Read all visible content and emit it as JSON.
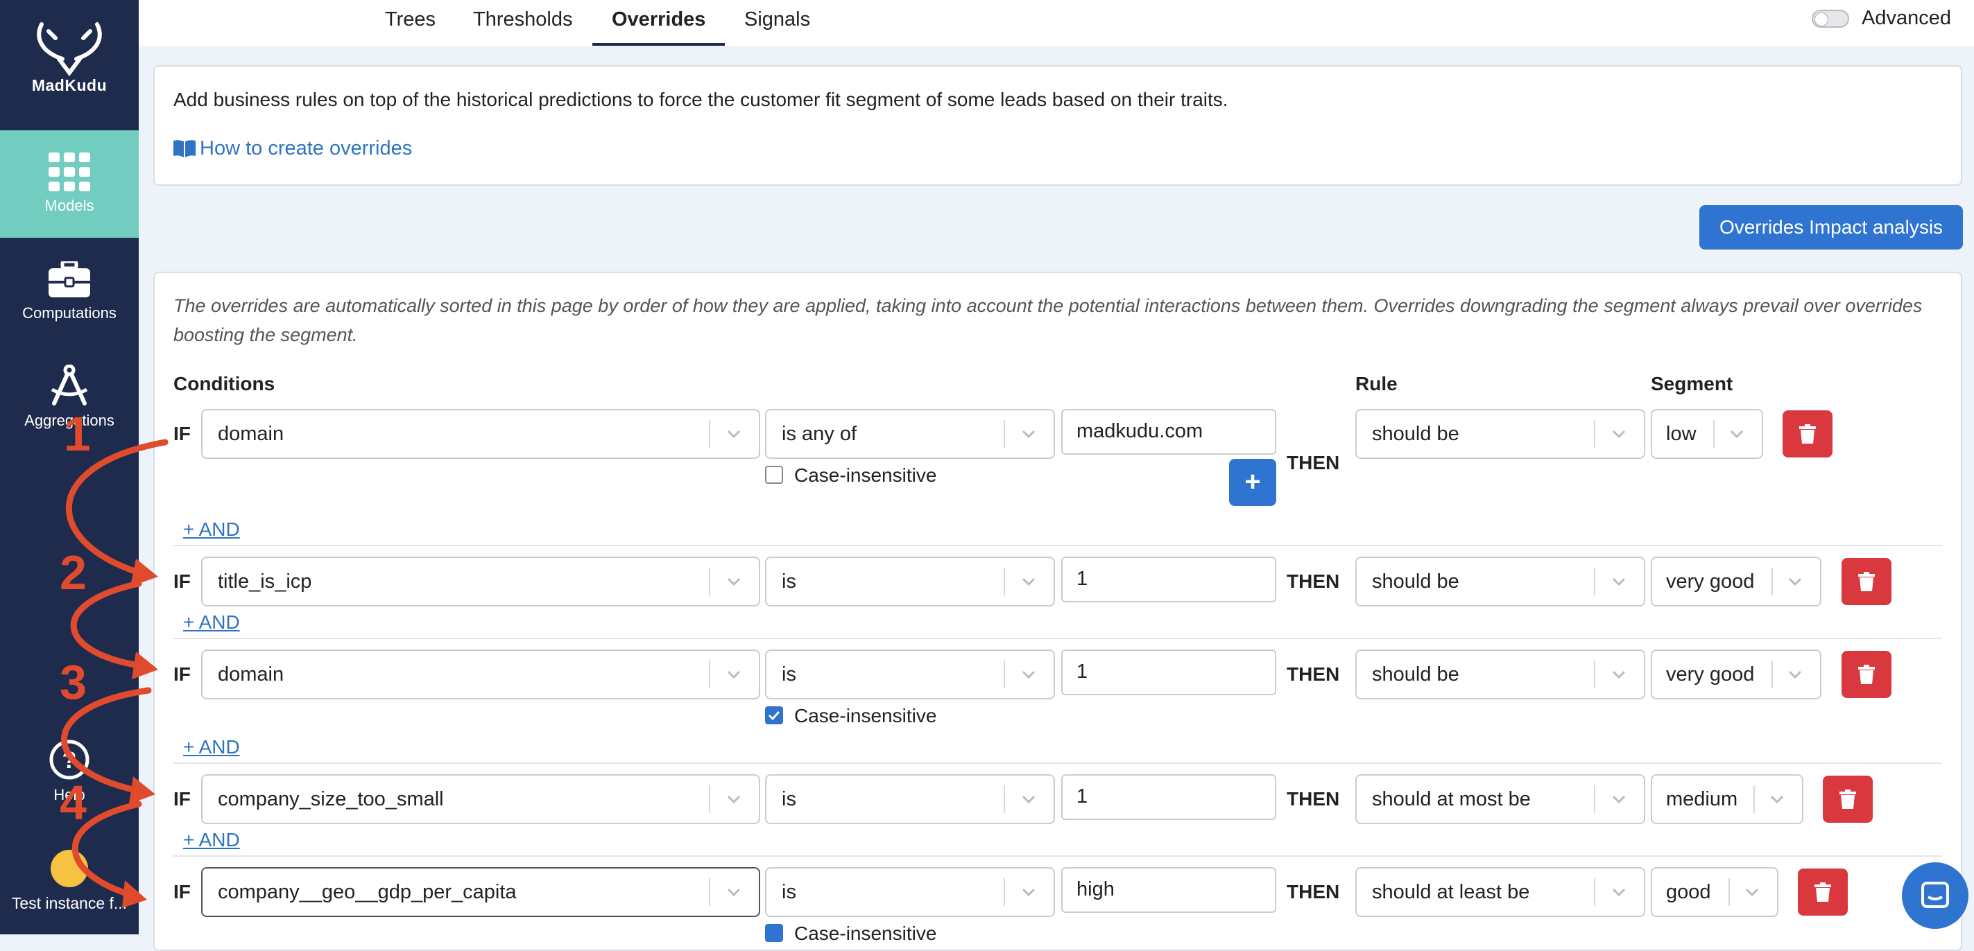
{
  "sidebar": {
    "logo_text": "MadKudu",
    "items": [
      {
        "label": "Models",
        "icon": "grid-icon"
      },
      {
        "label": "Computations",
        "icon": "toolbox-icon"
      },
      {
        "label": "Aggregations",
        "icon": "compass-icon"
      },
      {
        "label": "Help",
        "icon": "help-icon"
      },
      {
        "label": "Test instance f...",
        "icon": "avatar-icon"
      }
    ]
  },
  "tabs": [
    "Trees",
    "Thresholds",
    "Overrides",
    "Signals"
  ],
  "advanced_label": "Advanced",
  "intro_text": "Add business rules on top of the historical predictions to force the customer fit segment of some leads based on their traits.",
  "howto_link": "How to create overrides",
  "impact_button": "Overrides Impact analysis",
  "note": "The overrides are automatically sorted in this page by order of how they are applied, taking into account the potential interactions between them. Overrides downgrading the segment always prevail over overrides boosting the segment.",
  "headers": {
    "conditions": "Conditions",
    "rule": "Rule",
    "segment": "Segment"
  },
  "if_label": "IF",
  "then_label": "THEN",
  "and_label": "+ AND",
  "case_label": "Case-insensitive",
  "rules": [
    {
      "field": "domain",
      "operator": "is any of",
      "value": "madkudu.com",
      "rule": "should be",
      "segment": "low"
    },
    {
      "field": "title_is_icp",
      "operator": "is",
      "value": "1",
      "rule": "should be",
      "segment": "very good"
    },
    {
      "field": "domain",
      "operator": "is",
      "value": "1",
      "rule": "should be",
      "segment": "very good"
    },
    {
      "field": "company_size_too_small",
      "operator": "is",
      "value": "1",
      "rule": "should at most be",
      "segment": "medium"
    },
    {
      "field": "company__geo__gdp_per_capita",
      "operator": "is",
      "value": "high",
      "rule": "should at least be",
      "segment": "good"
    }
  ],
  "annotations": [
    "1",
    "2",
    "3",
    "4"
  ],
  "colors": {
    "sidebar": "#1f2b4d",
    "active": "#72cdc0",
    "primary": "#2f74d0",
    "danger": "#d9383f",
    "arrows": "#e04a2d"
  }
}
